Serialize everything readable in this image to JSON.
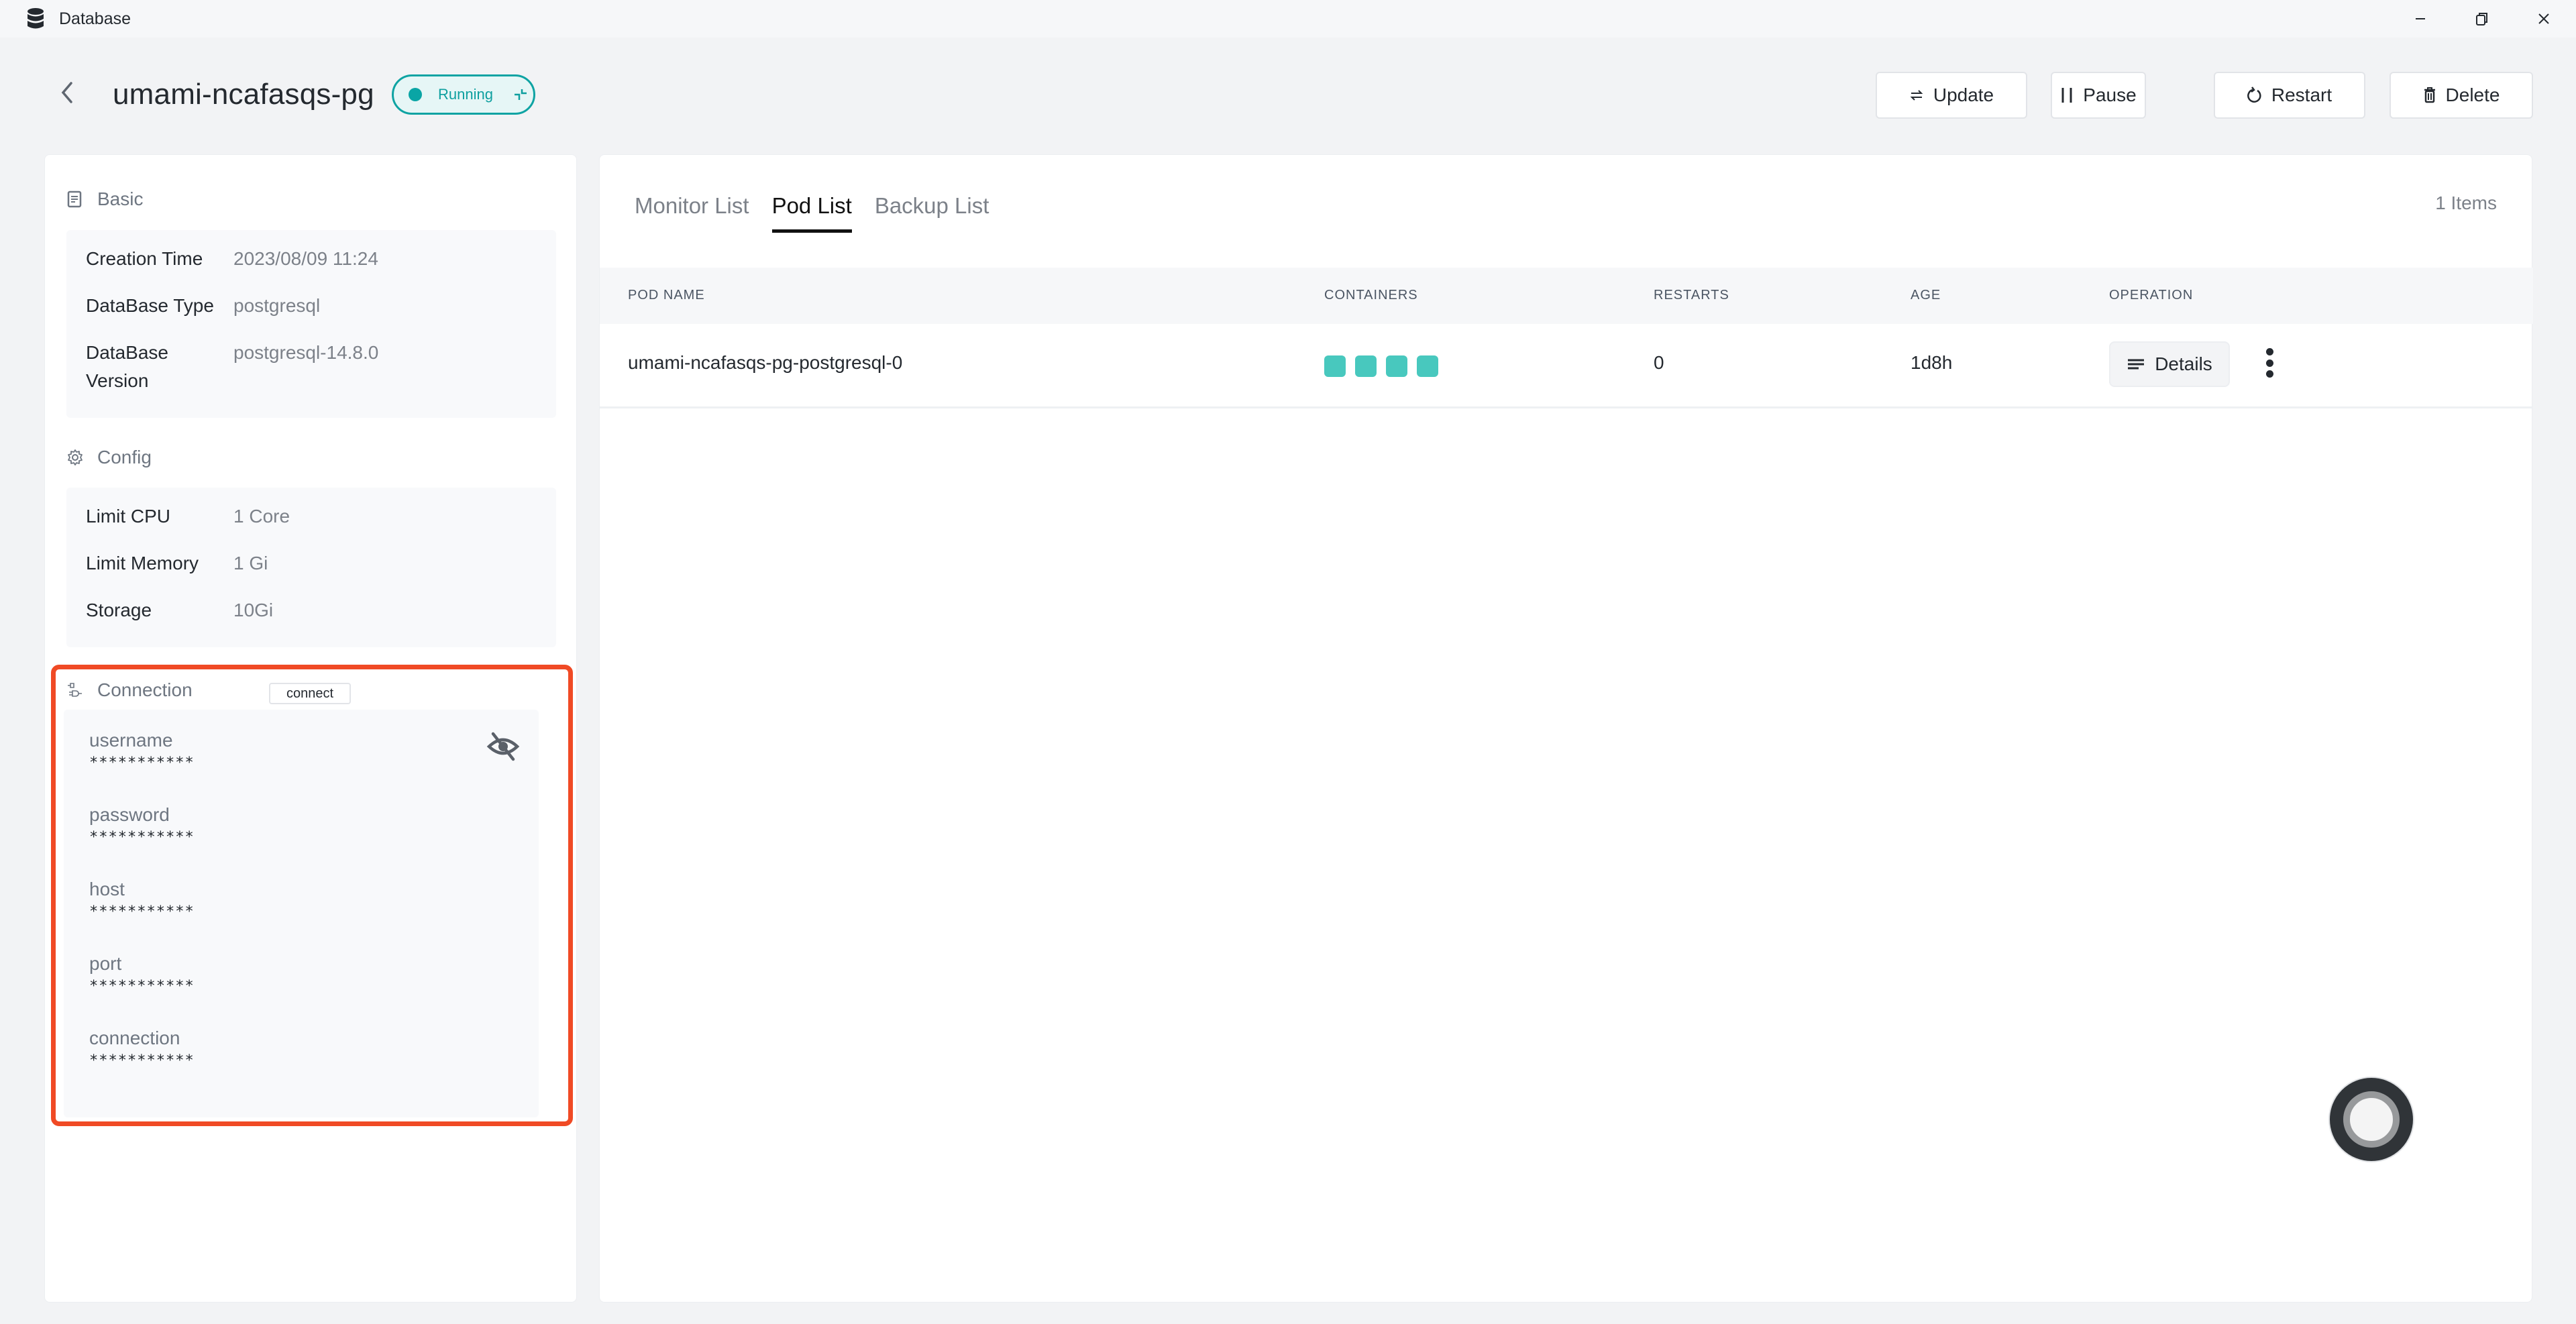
{
  "window": {
    "title": "Database",
    "controls": {
      "minimize": "–",
      "maximize": "❐",
      "close": "✕"
    }
  },
  "header": {
    "title": "umami-ncafasqs-pg",
    "status": {
      "label": "Running",
      "color": "#0fa3a3"
    },
    "actions": [
      {
        "label": "Update",
        "icon": "swap-icon"
      },
      {
        "label": "Pause",
        "icon": "pause-icon"
      },
      {
        "label": "Restart",
        "icon": "restart-icon"
      },
      {
        "label": "Delete",
        "icon": "trash-icon"
      }
    ]
  },
  "sidebar": {
    "basic": {
      "title": "Basic",
      "rows": [
        {
          "key": "Creation Time",
          "value": "2023/08/09 11:24"
        },
        {
          "key": "DataBase Type",
          "value": "postgresql"
        },
        {
          "key": "DataBase Version",
          "value": "postgresql-14.8.0"
        }
      ]
    },
    "config": {
      "title": "Config",
      "rows": [
        {
          "key": "Limit CPU",
          "value": "1 Core"
        },
        {
          "key": "Limit Memory",
          "value": "1 Gi"
        },
        {
          "key": "Storage",
          "value": "10Gi"
        }
      ]
    },
    "connection": {
      "title": "Connection",
      "connect_label": "connect",
      "highlight_color": "#f04a25",
      "fields": [
        {
          "label": "username",
          "value": "***********"
        },
        {
          "label": "password",
          "value": "***********"
        },
        {
          "label": "host",
          "value": "***********"
        },
        {
          "label": "port",
          "value": "***********"
        },
        {
          "label": "connection",
          "value": "***********"
        }
      ]
    }
  },
  "main": {
    "tabs": [
      {
        "label": "Monitor List",
        "active": false
      },
      {
        "label": "Pod List",
        "active": true
      },
      {
        "label": "Backup List",
        "active": false
      }
    ],
    "items_count": "1 Items",
    "table": {
      "columns": [
        "POD NAME",
        "CONTAINERS",
        "RESTARTS",
        "AGE",
        "OPERATION"
      ],
      "rows": [
        {
          "pod_name": "umami-ncafasqs-pg-postgresql-0",
          "containers": 4,
          "container_color": "#48c8be",
          "restarts": "0",
          "age": "1d8h",
          "details_label": "Details"
        }
      ]
    }
  }
}
